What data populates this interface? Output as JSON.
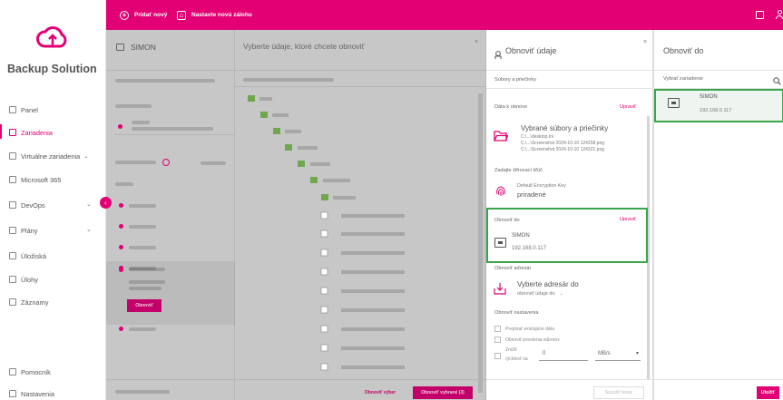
{
  "app": {
    "brand": "Backup Solution"
  },
  "topbar": {
    "add_label": "Pridať nový",
    "policy_label": "Nastavte novú zálohu"
  },
  "sidebar": {
    "items": [
      {
        "label": "Panel"
      },
      {
        "label": "Zariadenia"
      },
      {
        "label": "Virtuálne zariadenia"
      },
      {
        "label": "Microsoft 365"
      },
      {
        "label": "DevOps"
      },
      {
        "label": "Plány"
      },
      {
        "label": "Úložiská"
      },
      {
        "label": "Úlohy"
      },
      {
        "label": "Záznamy"
      }
    ],
    "bottom": [
      {
        "label": "Pomocník"
      },
      {
        "label": "Nastavenia"
      }
    ]
  },
  "col1": {
    "title": "SIMON"
  },
  "col2": {
    "title": "Vyberte údaje, ktoré chcete obnoviť"
  },
  "restore": {
    "title": "Obnoviť údaje",
    "tab": "Súbory a priečinky",
    "data_label": "Dáta k obnove",
    "data_edit": "Upraviť",
    "data_title": "Vybrané súbory a priečinky",
    "data_files": [
      "C:\\...\\desktop.ini",
      "C:\\...\\Screenshot 2024-10-10 124258.png",
      "C:\\...\\Screenshot 2024-10-10 124321.png"
    ],
    "key_label": "Zadajte šifrovací kľúč",
    "key_name": "Default Encryption Key",
    "key_status": "priradené",
    "to_label": "Obnoviť do",
    "to_edit": "Upraviť",
    "to_name": "SIMON",
    "to_ip": "192.168.0.117",
    "dir_label": "Obnoviť adresár",
    "dir_title": "Vyberte adresár do",
    "dir_sub": "obnoviť údaje do",
    "settings_label": "Obnoviť nastavenia",
    "opt1": "Prepísať existujúce dáta",
    "opt2": "Obnoviť povolenia súborov",
    "opt3a": "Znížiť",
    "opt3b": "rýchlosť na",
    "speed_value": "0",
    "speed_unit": "MB/s",
    "start_button": "Spustiť teraz"
  },
  "restore_to": {
    "title": "Obnoviť do",
    "select_label": "Vybrať zariadenie",
    "device_name": "SIMON",
    "device_ip": "192.168.0.117",
    "save_button": "Uložiť"
  },
  "dimmed": {
    "btn_restore": "Obnoviť",
    "btn_restore_selected": "Obnoviť výber",
    "btn_restore_count": "Obnoviť vybrané (3)"
  },
  "colors": {
    "accent": "#e20074",
    "green": "#3aa54a"
  }
}
